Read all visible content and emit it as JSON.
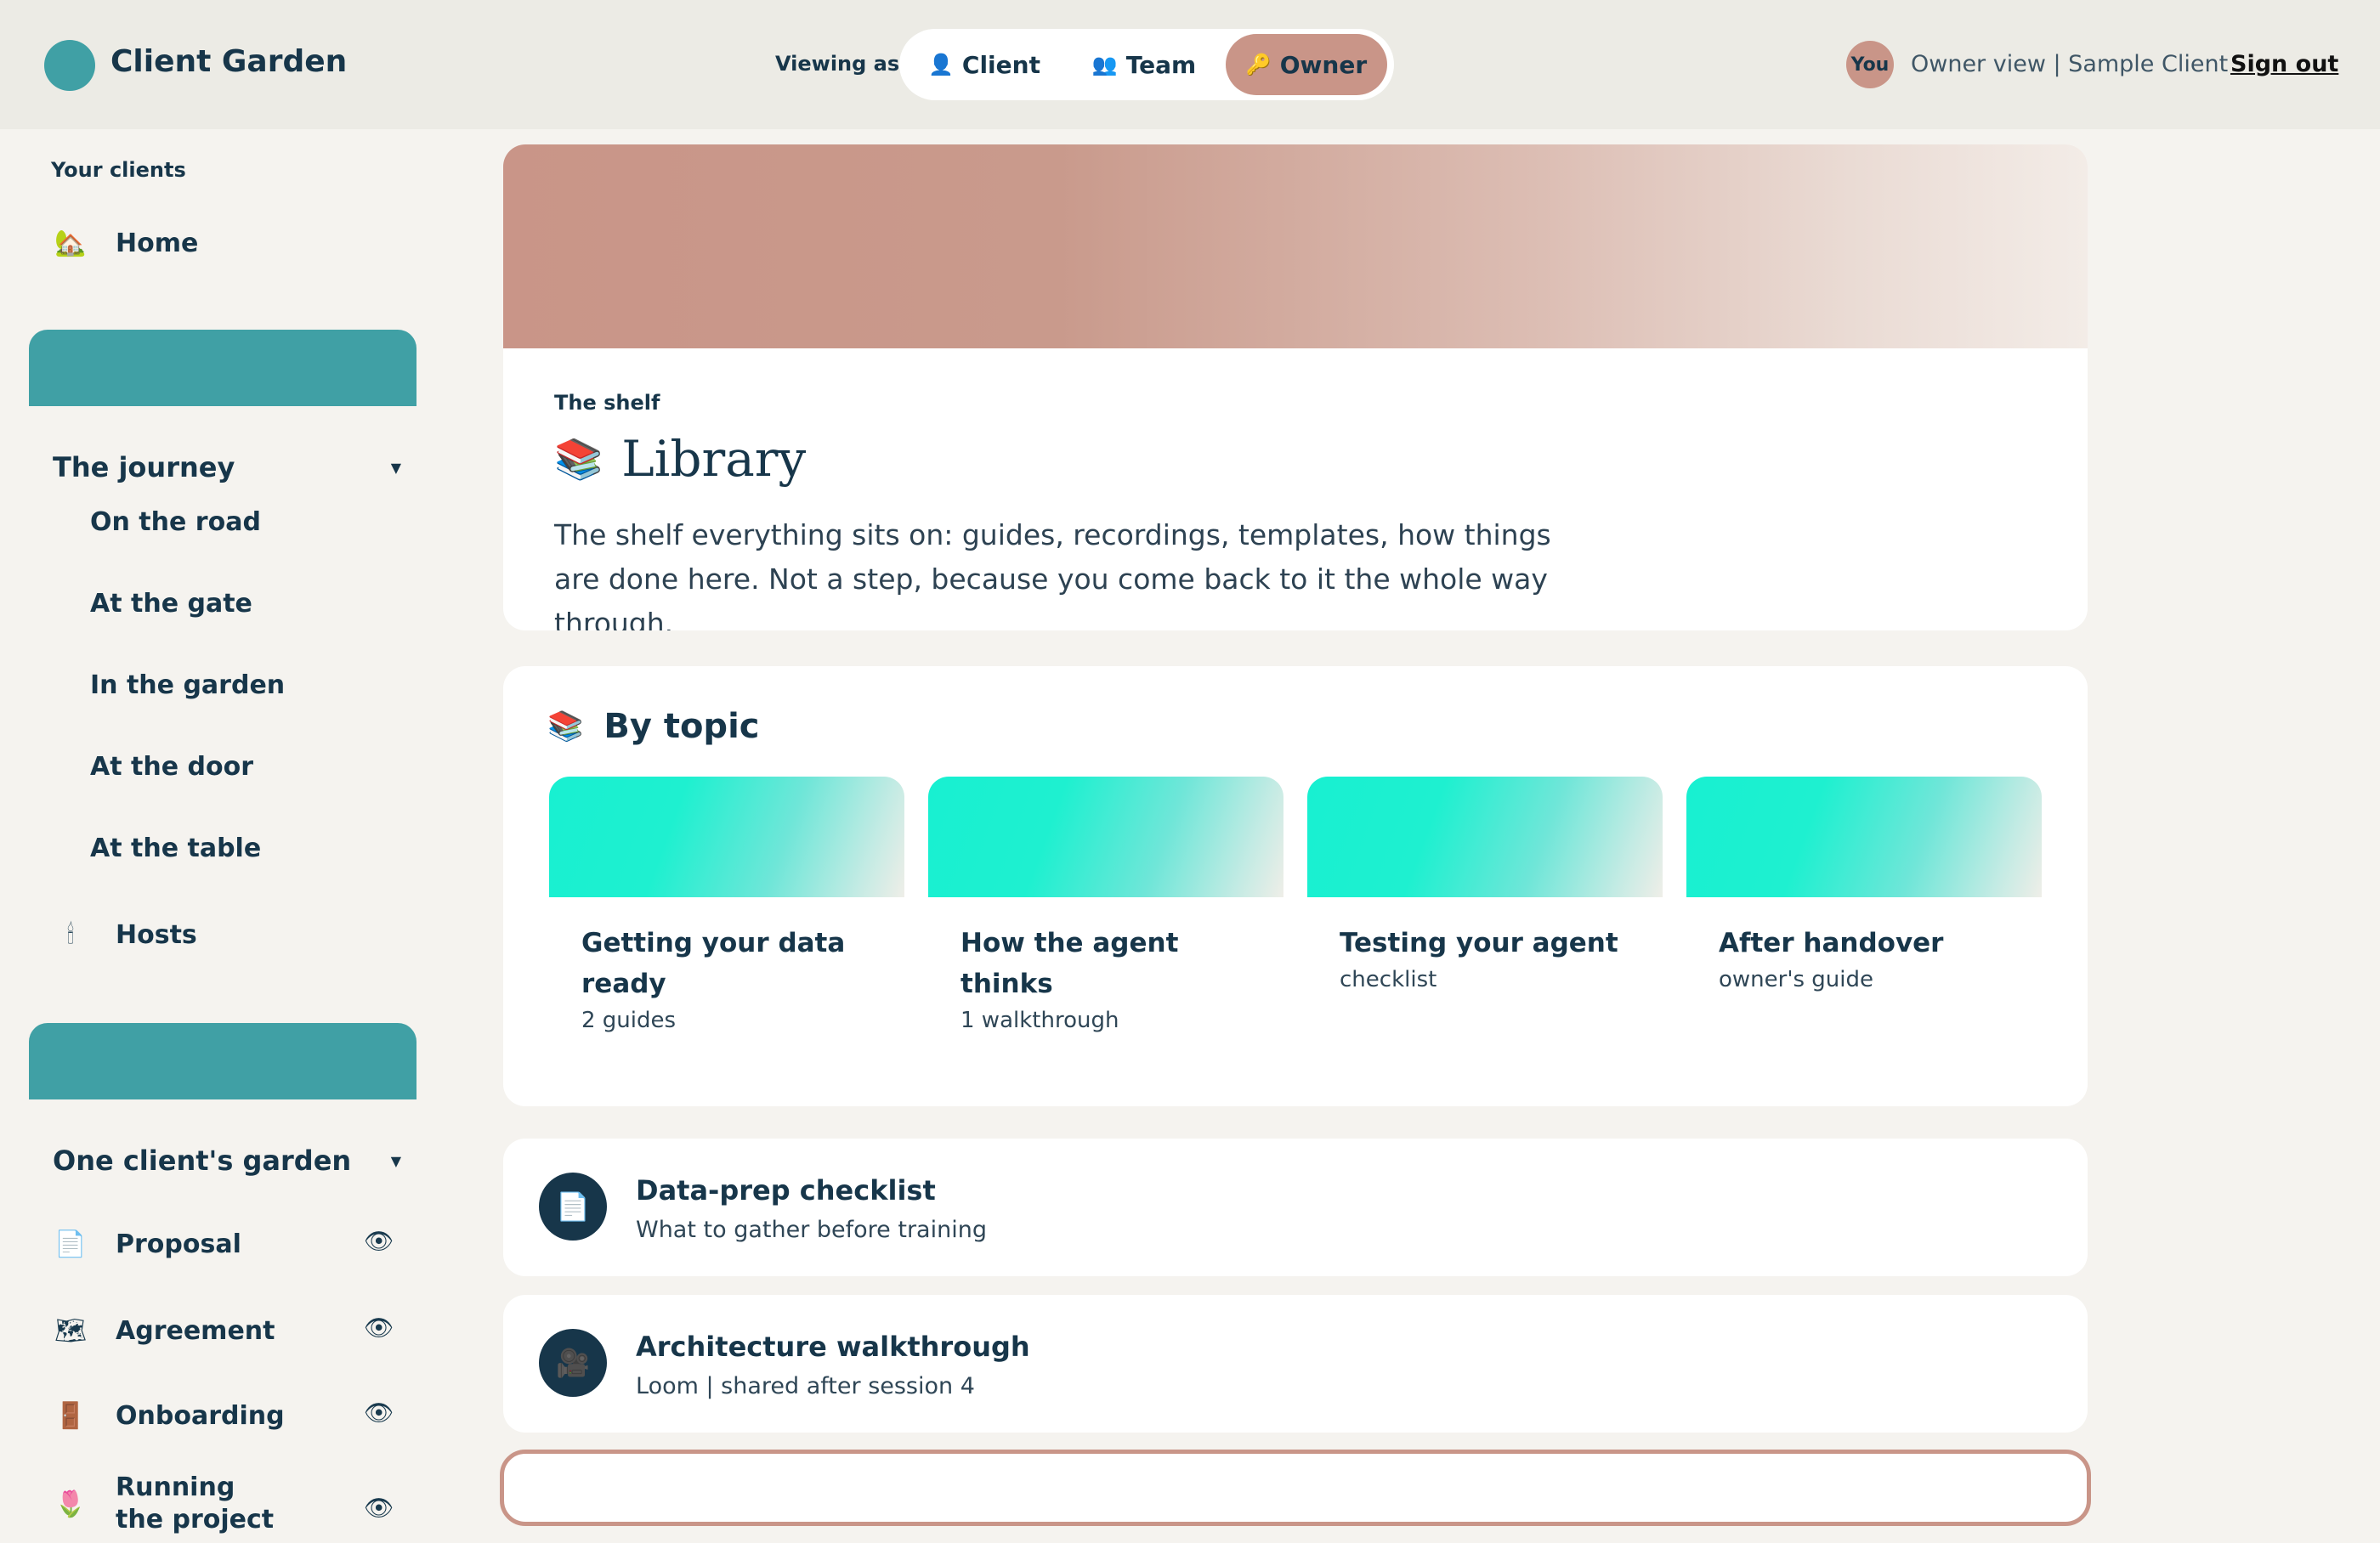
{
  "header": {
    "brand": "Client Garden",
    "viewing_label": "Viewing as",
    "view_options": [
      {
        "label": "Client",
        "icon": "👤",
        "icon_name": "user-icon"
      },
      {
        "label": "Team",
        "icon": "👥",
        "icon_name": "team-icon"
      },
      {
        "label": "Owner",
        "icon": "🔑",
        "icon_name": "key-icon"
      }
    ],
    "active_view": "Owner",
    "avatar": "You",
    "viewer_text": "Owner view | Sample Client",
    "signout": "Sign out"
  },
  "sidebar": {
    "caption": "Your clients",
    "home": {
      "label": "Home",
      "icon": "🏡",
      "icon_name": "home-icon"
    },
    "journey": {
      "title": "The journey",
      "caret": "▼",
      "items": [
        "On the road",
        "At the gate",
        "In the garden",
        "At the door",
        "At the table"
      ]
    },
    "hosts": {
      "label": "Hosts",
      "icon": "🕯",
      "icon_name": "candle-icon"
    },
    "garden": {
      "title": "One client's garden",
      "caret": "▼",
      "items": [
        {
          "label": "Proposal",
          "icon": "📄",
          "icon_name": "document-icon"
        },
        {
          "label": "Agreement",
          "icon": "🗺",
          "icon_name": "map-icon"
        },
        {
          "label": "Onboarding",
          "icon": "🚪",
          "icon_name": "door-icon"
        },
        {
          "label": "Running\nthe project",
          "icon": "🌷",
          "icon_name": "tulip-icon"
        }
      ],
      "eye_icon": "👁"
    }
  },
  "library": {
    "eyebrow": "The shelf",
    "icon": "📚",
    "title": "Library",
    "description": "The shelf everything sits on: guides, recordings, templates, how things are done here. Not a step, because you come back to it the whole way through."
  },
  "topics": {
    "icon": "📚",
    "heading": "By topic",
    "cards": [
      {
        "title": "Getting your data ready",
        "sub": "2 guides"
      },
      {
        "title": "How the agent thinks",
        "sub": "1 walkthrough"
      },
      {
        "title": "Testing your agent",
        "sub": "checklist"
      },
      {
        "title": "After handover",
        "sub": "owner's guide"
      }
    ]
  },
  "resources": [
    {
      "icon": "📄",
      "icon_name": "document-icon",
      "title": "Data-prep checklist",
      "sub": "What to gather before training"
    },
    {
      "icon": "🎥",
      "icon_name": "video-camera-icon",
      "title": "Architecture walkthrough",
      "sub": "Loom | shared after session 4"
    }
  ],
  "colors": {
    "accent_teal": "#40a0a5",
    "accent_rose": "#c99588",
    "navy": "#17364a",
    "topic_mint": "#18f0d1"
  }
}
